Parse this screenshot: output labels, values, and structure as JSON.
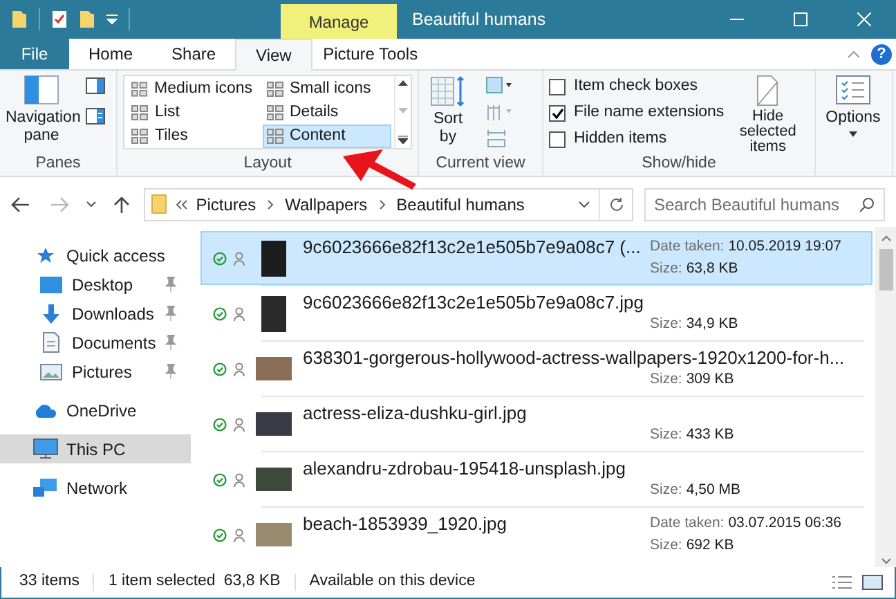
{
  "window": {
    "title": "Beautiful humans",
    "context_tab": "Manage",
    "help": "?"
  },
  "tabs": [
    {
      "label": "File",
      "kind": "file",
      "selected": false
    },
    {
      "label": "Home",
      "kind": "tab",
      "selected": false
    },
    {
      "label": "Share",
      "kind": "tab",
      "selected": false
    },
    {
      "label": "View",
      "kind": "tab",
      "selected": true
    },
    {
      "label": "Picture Tools",
      "kind": "context",
      "selected": false
    }
  ],
  "ribbon": {
    "panes": {
      "label": "Panes",
      "navigation_pane": "Navigation pane"
    },
    "layout": {
      "label": "Layout",
      "options": [
        {
          "label": "Medium icons",
          "selected": false
        },
        {
          "label": "Small icons",
          "selected": false
        },
        {
          "label": "List",
          "selected": false
        },
        {
          "label": "Details",
          "selected": false
        },
        {
          "label": "Tiles",
          "selected": false
        },
        {
          "label": "Content",
          "selected": true
        }
      ]
    },
    "current_view": {
      "label": "Current view",
      "sort_by": "Sort by"
    },
    "show_hide": {
      "label": "Show/hide",
      "checkboxes": [
        {
          "label": "Item check boxes",
          "checked": false
        },
        {
          "label": "File name extensions",
          "checked": true
        },
        {
          "label": "Hidden items",
          "checked": false
        }
      ],
      "hide_selected": "Hide selected items"
    },
    "options": {
      "label": "Options"
    }
  },
  "address_bar": {
    "breadcrumb": [
      "Pictures",
      "Wallpapers",
      "Beautiful humans"
    ],
    "search": {
      "placeholder": "Search Beautiful humans"
    }
  },
  "sidebar": {
    "items": [
      {
        "label": "Quick access",
        "selected": false,
        "children": [
          {
            "label": "Desktop",
            "pinned": true,
            "selected": false
          },
          {
            "label": "Downloads",
            "pinned": true,
            "selected": false
          },
          {
            "label": "Documents",
            "pinned": true,
            "selected": false
          },
          {
            "label": "Pictures",
            "pinned": true,
            "selected": false
          }
        ]
      },
      {
        "label": "OneDrive",
        "selected": false
      },
      {
        "label": "This PC",
        "selected": true
      },
      {
        "label": "Network",
        "selected": false
      }
    ]
  },
  "files": [
    {
      "name": "9c6023666e82f13c2e1e505b7e9a08c7 (...",
      "selected": true,
      "details": [
        {
          "label": "Date taken:",
          "value": "10.05.2019 19:07"
        },
        {
          "label": "Size:",
          "value": "63,8 KB"
        }
      ]
    },
    {
      "name": "9c6023666e82f13c2e1e505b7e9a08c7.jpg",
      "selected": false,
      "details": [
        {
          "label": "Size:",
          "value": "34,9 KB"
        }
      ]
    },
    {
      "name": "638301-gorgerous-hollywood-actress-wallpapers-1920x1200-for-h...",
      "selected": false,
      "details": [
        {
          "label": "Size:",
          "value": "309 KB"
        }
      ]
    },
    {
      "name": "actress-eliza-dushku-girl.jpg",
      "selected": false,
      "details": [
        {
          "label": "Size:",
          "value": "433 KB"
        }
      ]
    },
    {
      "name": "alexandru-zdrobau-195418-unsplash.jpg",
      "selected": false,
      "details": [
        {
          "label": "Size:",
          "value": "4,50 MB"
        }
      ]
    },
    {
      "name": "beach-1853939_1920.jpg",
      "selected": false,
      "details": [
        {
          "label": "Date taken:",
          "value": "03.07.2015 06:36"
        },
        {
          "label": "Size:",
          "value": "692 KB"
        }
      ]
    }
  ],
  "status_bar": {
    "item_count": "33 items",
    "selection": "1 item selected",
    "selection_size": "63,8 KB",
    "availability": "Available on this device"
  }
}
